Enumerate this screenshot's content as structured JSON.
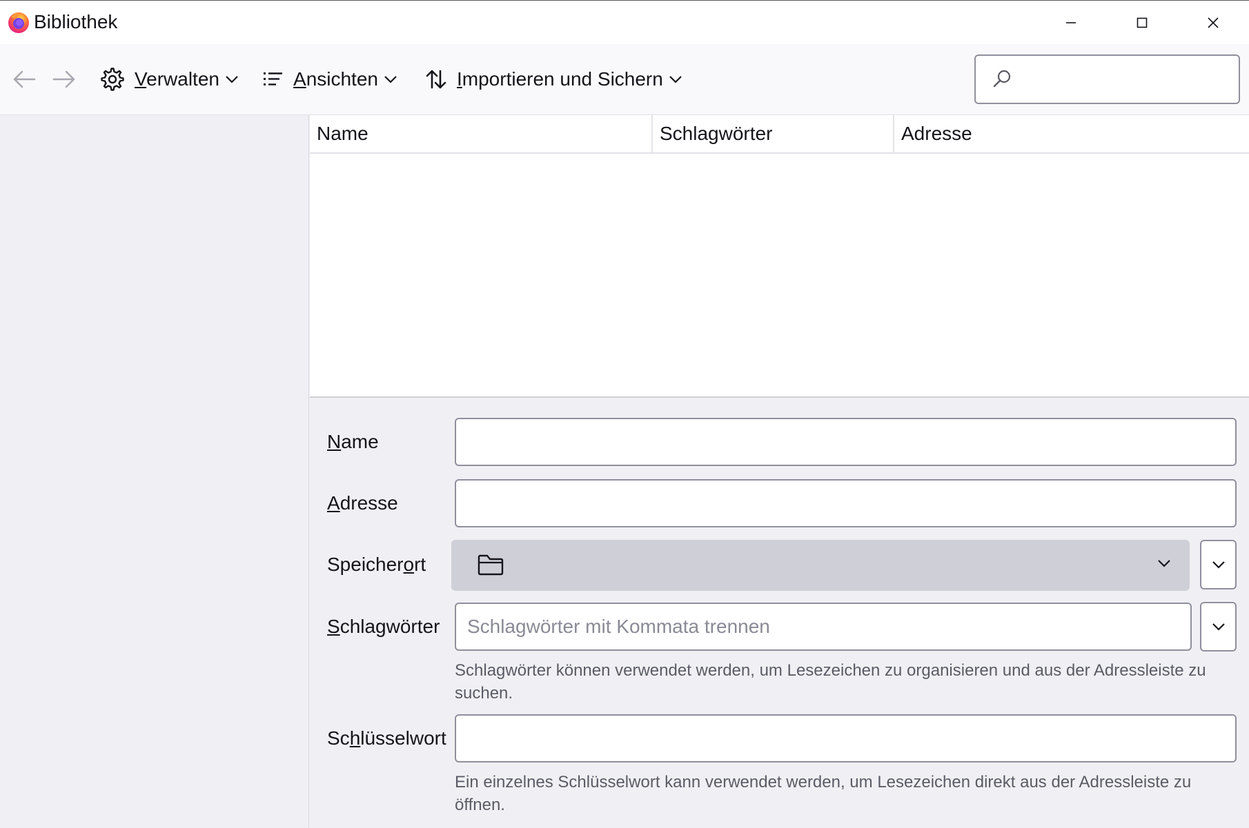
{
  "window": {
    "title": "Bibliothek",
    "controls": {
      "minimize": "minimize-icon",
      "maximize": "maximize-icon",
      "close": "close-icon"
    }
  },
  "toolbar": {
    "back_icon": "arrow-left-icon",
    "forward_icon": "arrow-right-icon",
    "manage": {
      "accel": "V",
      "rest": "erwalten",
      "icon": "gear-icon"
    },
    "views": {
      "accel": "A",
      "rest": "nsichten",
      "icon": "list-icon"
    },
    "import": {
      "accel": "I",
      "rest": "mportieren und Sichern",
      "icon": "sort-arrows-icon"
    },
    "search": {
      "value": "",
      "placeholder": "",
      "icon": "search-icon"
    }
  },
  "table": {
    "columns": [
      "Name",
      "Schlagwörter",
      "Adresse"
    ],
    "rows": []
  },
  "details": {
    "name": {
      "before": "",
      "accel": "N",
      "after": "ame",
      "value": ""
    },
    "url": {
      "before": "",
      "accel": "A",
      "after": "dresse",
      "value": ""
    },
    "location": {
      "before": "Speicher",
      "accel": "o",
      "after": "rt",
      "value": "",
      "icon": "folder-icon"
    },
    "tags": {
      "before": "",
      "accel": "S",
      "after": "chlagwörter",
      "value": "",
      "placeholder": "Schlagwörter mit Kommata trennen",
      "hint": "Schlagwörter können verwendet werden, um Lesezeichen zu organisieren und aus der Adressleiste zu suchen."
    },
    "keyword": {
      "before": "Sc",
      "accel": "h",
      "after": "lüsselwort",
      "value": "",
      "hint": "Ein einzelnes Schlüsselwort kann verwendet werden, um Lesezeichen direkt aus der Adressleiste zu öffnen."
    }
  },
  "colors": {
    "accent": "#0061e0",
    "border": "#8f8f9d",
    "panel": "#f0f0f4",
    "select": "#cfcfd8"
  }
}
